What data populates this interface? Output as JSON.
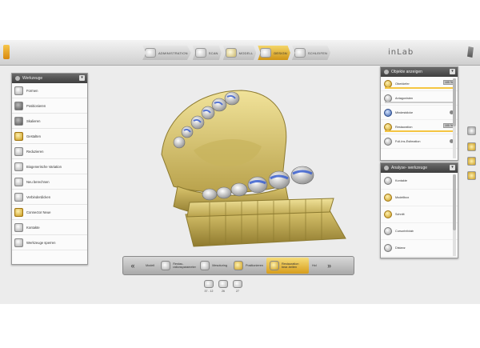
{
  "topbar": {
    "steps": [
      {
        "label": "ADMINISTRATION",
        "active": false
      },
      {
        "label": "SCAN",
        "active": false
      },
      {
        "label": "MODELL",
        "active": false
      },
      {
        "label": "DESIGN",
        "active": true
      },
      {
        "label": "SCHLEIFEN",
        "active": false
      }
    ],
    "logo": "inLab"
  },
  "left_panel": {
    "title": "Werkzeuge",
    "tools": [
      {
        "label": "Formen",
        "icon": "form-icon"
      },
      {
        "label": "Positionieren",
        "icon": "position-icon"
      },
      {
        "label": "Skalieren",
        "icon": "scale-icon"
      },
      {
        "label": "Gestalten",
        "icon": "shape-icon"
      },
      {
        "label": "Reduzieren",
        "icon": "reduce-icon"
      },
      {
        "label": "Biogenerische Variation",
        "icon": "variation-icon"
      },
      {
        "label": "Neu berechnen",
        "icon": "recalculate-icon"
      },
      {
        "label": "Verbinderdicken",
        "icon": "connector-icon"
      },
      {
        "label": "Connector Neue",
        "icon": "connector-new-icon"
      },
      {
        "label": "Kontakte",
        "icon": "contacts-icon"
      },
      {
        "label": "Werkzeuge sperren",
        "icon": "lock-tools-icon"
      }
    ]
  },
  "objects_panel": {
    "title": "Objekte anzeigen",
    "rows": [
      {
        "label": "Oberkiefer",
        "value": "100 %",
        "slider": 1.0
      },
      {
        "label": "Antagonisten",
        "value": "",
        "slider": 0.0
      },
      {
        "label": "Mindestdicke",
        "value": "",
        "slider": null
      },
      {
        "label": "Restauration",
        "value": "100 %",
        "slider": 1.0
      },
      {
        "label": "Full-Ins-Estimation",
        "value": "",
        "slider": null
      }
    ]
  },
  "analysis_panel": {
    "title": "Analyse- werkzeuge",
    "rows": [
      {
        "label": "Kontakte"
      },
      {
        "label": "Modellbox"
      },
      {
        "label": "Schnitt"
      },
      {
        "label": "Cursorinfotab"
      },
      {
        "label": "Distanz"
      }
    ]
  },
  "bottom_steps": {
    "back": "Modell",
    "steps": [
      {
        "label": "Restau-rationsparameter",
        "active": false
      },
      {
        "label": "Mesoturing",
        "active": false
      },
      {
        "label": "Positionieren",
        "active": false
      },
      {
        "label": "Restauration bear-beiten",
        "active": true
      }
    ],
    "next": "Hol"
  },
  "tooth_selector": [
    {
      "label": "37 - 12"
    },
    {
      "label": "26"
    },
    {
      "label": "27"
    }
  ],
  "colors": {
    "accent_gold": "#d79d1c",
    "panel_header": "#4a4a4a",
    "model_yellow": "#e3d27e",
    "restoration_blue": "#3a5fcf"
  }
}
